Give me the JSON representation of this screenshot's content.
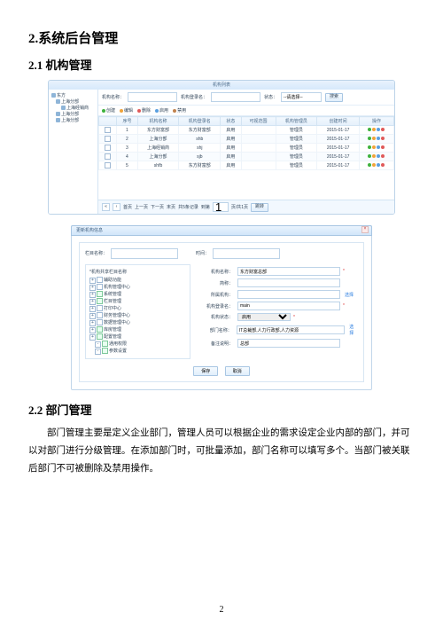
{
  "headings": {
    "h2": "2.系统后台管理",
    "h2_1": "2.1 机构管理",
    "h2_2": "2.2 部门管理"
  },
  "page_number": "2",
  "dept_paragraph": "部门管理主要是定义企业部门，管理人员可以根据企业的需求设定企业内部的部门，并可以对部门进行分级管理。在添加部门时，可批量添加，部门名称可以填写多个。当部门被关联后部门不可被删除及禁用操作。",
  "list": {
    "title": "机构列表",
    "tree": {
      "root": "东方",
      "items": [
        "上海分部",
        "上海经销商",
        "上海分部",
        "上海分部"
      ]
    },
    "search": {
      "org_label": "机构名称：",
      "login_label": "机构登录名：",
      "status_label": "状态：",
      "status_value": "--请选择--",
      "btn": "搜索"
    },
    "toolbar": {
      "create": "创建",
      "edit": "编辑",
      "delete": "删除",
      "enable": "启用",
      "disable": "禁用"
    },
    "columns": [
      "",
      "序号",
      "机构名称",
      "机构登录名",
      "状态",
      "可视范围",
      "机构管理员",
      "创建时间",
      "操作"
    ],
    "rows": [
      {
        "n": "1",
        "name": "东方财富部",
        "login": "东方财富部",
        "status": "启用",
        "scope": "",
        "admin": "管理员",
        "date": "2015-01-17"
      },
      {
        "n": "2",
        "name": "上海分部",
        "login": "shb",
        "status": "启用",
        "scope": "",
        "admin": "管理员",
        "date": "2015-01-17"
      },
      {
        "n": "3",
        "name": "上海经销商",
        "login": "shj",
        "status": "启用",
        "scope": "",
        "admin": "管理员",
        "date": "2015-01-17"
      },
      {
        "n": "4",
        "name": "上海分部",
        "login": "sjb",
        "status": "启用",
        "scope": "",
        "admin": "管理员",
        "date": "2015-01-17"
      },
      {
        "n": "5",
        "name": "shfb",
        "login": "东方财富部",
        "status": "启用",
        "scope": "",
        "admin": "管理员",
        "date": "2015-01-17"
      }
    ],
    "pager": {
      "first": "首页",
      "prev": "上一页",
      "next": "下一页",
      "last": "末页",
      "totalrec": "共5条记录",
      "goto": "到第",
      "page_of": "页/共1页",
      "go": "跳转"
    }
  },
  "dialog": {
    "title": "更新机构信息",
    "col_label": "栏目名称：",
    "time_label": "时间：",
    "tree_header": "机构共享栏目名称",
    "tree_items": [
      {
        "exp": true,
        "chk": false,
        "label": "辅助功能"
      },
      {
        "exp": true,
        "chk": false,
        "label": "机构管理中心"
      },
      {
        "exp": true,
        "chk": true,
        "label": "系统管理"
      },
      {
        "exp": true,
        "chk": true,
        "label": "栏目管理"
      },
      {
        "exp": true,
        "chk": false,
        "label": "打印中心"
      },
      {
        "exp": true,
        "chk": false,
        "label": "财务管理中心"
      },
      {
        "exp": true,
        "chk": false,
        "label": "数据管理中心"
      },
      {
        "exp": true,
        "chk": true,
        "label": "库房管理"
      },
      {
        "exp": true,
        "chk": true,
        "label": "配置管理"
      },
      {
        "exp": false,
        "chk": true,
        "label": "通用权限",
        "child": true
      },
      {
        "exp": false,
        "chk": true,
        "label": "参数设置",
        "child": true
      }
    ],
    "form": {
      "org_name": {
        "label": "机构名称：",
        "value": "东方财富总部"
      },
      "short_name": {
        "label": "简称：",
        "value": ""
      },
      "parent": {
        "label": "所属机构：",
        "value": "",
        "link": "选择"
      },
      "login": {
        "label": "机构登录名：",
        "value": "main"
      },
      "status": {
        "label": "机构状态：",
        "value": "启用"
      },
      "dept": {
        "label": "部门名称：",
        "value": "IT总裁部,人力行政部,人力资源",
        "link": "选择"
      },
      "remark": {
        "label": "备注说明：",
        "value": "总部"
      }
    },
    "buttons": {
      "save": "保存",
      "cancel": "取消"
    }
  }
}
